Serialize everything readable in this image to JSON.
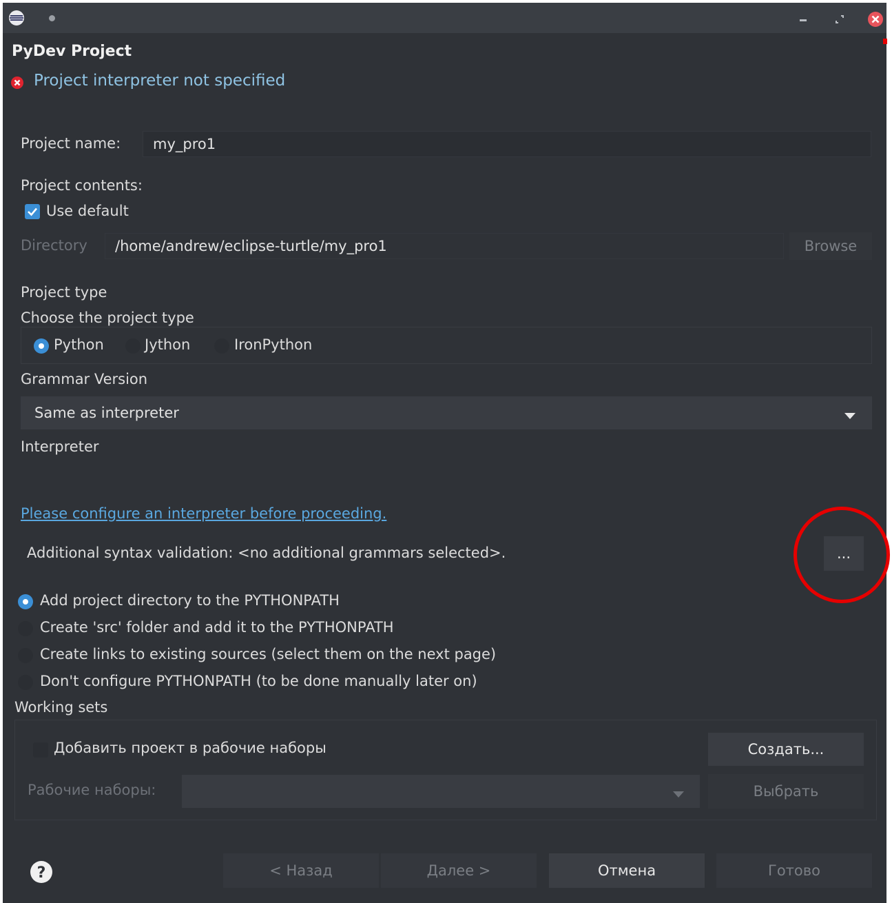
{
  "dialog": {
    "title": "PyDev Project",
    "error_message": "Project interpreter not specified"
  },
  "project_name": {
    "label": "Project name:",
    "value": "my_pro1"
  },
  "project_contents": {
    "label": "Project contents:",
    "use_default_label": "Use default",
    "use_default_checked": true,
    "directory_label": "Directory",
    "directory_value": "/home/andrew/eclipse-turtle/my_pro1",
    "browse_label": "Browse"
  },
  "project_type": {
    "label": "Project type",
    "choose_label": "Choose the project type",
    "options": [
      "Python",
      "Jython",
      "IronPython"
    ],
    "selected": "Python"
  },
  "grammar": {
    "label": "Grammar Version",
    "selected": "Same as interpreter"
  },
  "interpreter": {
    "label": "Interpreter",
    "configure_link": "Please configure an interpreter before proceeding."
  },
  "syntax_validation": {
    "text": "Additional syntax validation: <no additional grammars selected>.",
    "more_button": "..."
  },
  "pythonpath": {
    "options": [
      "Add project directory to the PYTHONPATH",
      "Create 'src' folder and add it to the PYTHONPATH",
      "Create links to existing sources (select them on the next page)",
      "Don't configure PYTHONPATH (to be done manually later on)"
    ],
    "selected_index": 0
  },
  "working_sets": {
    "label": "Working sets",
    "add_label": "Добавить проект в рабочие наборы",
    "create_button": "Создать...",
    "sets_label": "Рабочие наборы:",
    "select_button": "Выбрать"
  },
  "footer": {
    "back_button": "< Назад",
    "next_button": "Далее >",
    "cancel_button": "Отмена",
    "finish_button": "Готово"
  },
  "colors": {
    "background": "#2f3237",
    "accent": "#3b8fd6",
    "error": "#e0242f",
    "link": "#5aa8e0",
    "annotation": "#e60000"
  },
  "icons": [
    "eclipse-icon",
    "dot-icon",
    "minimize-icon",
    "restore-icon",
    "close-icon",
    "error-icon",
    "chevron-down-icon",
    "help-icon"
  ]
}
